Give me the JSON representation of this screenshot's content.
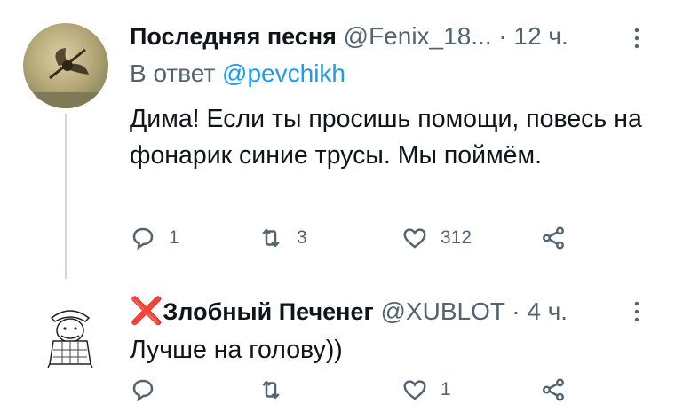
{
  "tweets": [
    {
      "name": "Последняя песня",
      "handle": "@Fenix_18...",
      "separator": "·",
      "time": "12 ч.",
      "reply_prefix": "В ответ",
      "reply_mention": "@pevchikh",
      "text": "Дима! Если ты просишь помощи, повесь на фонарик синие трусы. Мы поймём.",
      "reply_count": "1",
      "retweet_count": "3",
      "like_count": "312"
    },
    {
      "name_prefix": "❌",
      "name": "Злобный Печенег",
      "handle": "@XUBLOT",
      "separator": "·",
      "time": "4 ч.",
      "text": "Лучше на голову))",
      "reply_count": "",
      "retweet_count": "",
      "like_count": "1"
    }
  ],
  "icons": {
    "more": "more-vertical-icon",
    "reply": "reply-icon",
    "retweet": "retweet-icon",
    "like": "heart-icon",
    "share": "share-icon"
  },
  "colors": {
    "accent": "#1d9bf0",
    "secondary_text": "#536471",
    "cross": "#e0245e"
  }
}
